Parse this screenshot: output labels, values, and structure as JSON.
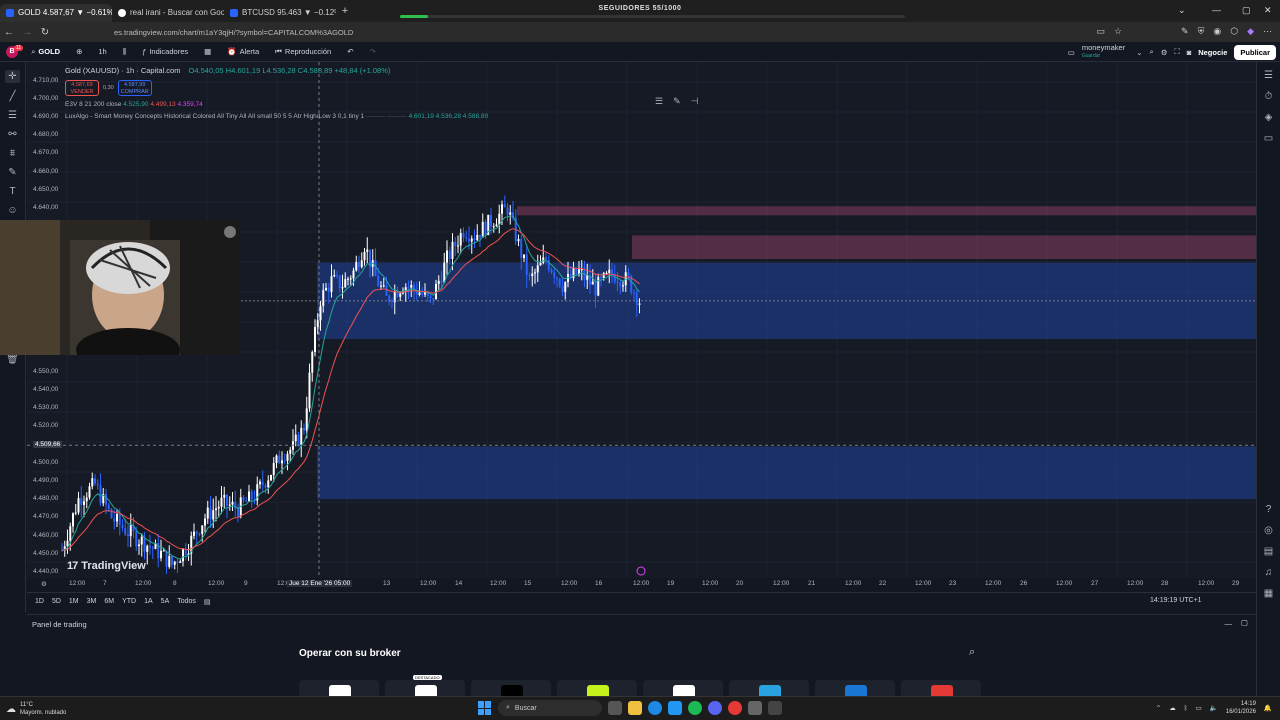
{
  "browser": {
    "tabs": [
      {
        "label": "GOLD 4.587,67 ▼ −0.61% mon",
        "active": true
      },
      {
        "label": "real irani - Buscar con Google",
        "active": false
      },
      {
        "label": "BTCUSD 95.463 ▼ −0.12% mo",
        "active": false
      }
    ],
    "new_tab": "+",
    "window_title": "SEGUIDORES 55/1000",
    "followers_progress": 0.055,
    "url": "es.tradingview.com/chart/m1aY3qjH/?symbol=CAPITALCOM%3AGOLD"
  },
  "toolbar": {
    "symbol": "GOLD",
    "interval": "1h",
    "indicators_label": "Indicadores",
    "alert_label": "Alerta",
    "replay_label": "Reproducción",
    "account_name": "moneymaker",
    "account_sub": "Guardar",
    "trade_label": "Negocie",
    "publish_label": "Publicar",
    "notification_count": "11"
  },
  "legend": {
    "title": "Gold (XAUUSD) · 1h · Capital.com",
    "ohlc": "O4.540,05 H4.601,19 L4.536,28 C4.588,89 +48,84 (+1.08%)",
    "sell_price": "4.587,69",
    "sell_label": "VENDER",
    "spread": "0,30",
    "buy_price": "4.587,99",
    "buy_label": "COMPRAR",
    "ema_label": "E3V 8 21 200 close",
    "ema_v1": "4.525,90",
    "ema_v2": "4.499,13",
    "ema_v3": "4.359,74",
    "luxalgo_label": "LuxAlgo - Smart Money Concepts Historical Colored All Tiny All All small 50 5 5 Atr High/Low 3 0,1 tiny 1",
    "luxalgo_values": "4.601,19  4.536,28  4.588,89"
  },
  "price_axis": {
    "labels": [
      "4.710,00",
      "4.700,00",
      "4.690,00",
      "4.680,00",
      "4.670,00",
      "4.660,00",
      "4.650,00",
      "4.640,00",
      "4.550,00",
      "4.540,00",
      "4.530,00",
      "4.520,00",
      "4.509,66",
      "4.500,00",
      "4.490,00",
      "4.480,00",
      "4.470,00",
      "4.460,00",
      "4.450,00",
      "4.440,00"
    ],
    "crosshair_price": "4.509,66"
  },
  "time_axis": {
    "labels": [
      "12:00",
      "7",
      "12:00",
      "8",
      "12:00",
      "9",
      "12:00",
      "Jue 12 Ene '26",
      "05:00",
      "13",
      "12:00",
      "14",
      "12:00",
      "15",
      "12:00",
      "16",
      "12:00",
      "19",
      "12:00",
      "20",
      "12:00",
      "21",
      "12:00",
      "22",
      "12:00",
      "23",
      "12:00",
      "26",
      "12:00",
      "27",
      "12:00",
      "28",
      "12:00",
      "29"
    ],
    "highlight": "Jue 12 Ene '26   05:00"
  },
  "watermark": "TradingView",
  "ranges": [
    "1D",
    "5D",
    "1M",
    "3M",
    "6M",
    "YTD",
    "1A",
    "5A",
    "Todos"
  ],
  "clock": "14:19:19 UTC+1",
  "panel": {
    "header": "Panel de trading",
    "title": "Operar con su broker",
    "featured_tag": "DESTACADO",
    "broker_colors": [
      "#ffffff",
      "#ffffff",
      "#000000",
      "#c6f21b",
      "#ffffff",
      "#29a3e0",
      "#1976d2",
      "#e53935"
    ]
  },
  "taskbar": {
    "temperature": "11°C",
    "weather": "Mayorm. nublado",
    "search": "Buscar",
    "time": "14:19",
    "date": "16/01/2026"
  },
  "colors": {
    "bull": "#ffffff",
    "bear": "#2962ff",
    "supply_zone": "#f06292",
    "demand_zone": "#2962ff",
    "ema_fast": "#26a69a",
    "ema_slow": "#ef5350"
  },
  "chart_data": {
    "type": "candlestick",
    "symbol": "GOLD",
    "interval": "1h",
    "close_path": [
      [
        0,
        4452
      ],
      [
        6,
        4480
      ],
      [
        12,
        4488
      ],
      [
        18,
        4470
      ],
      [
        24,
        4462
      ],
      [
        30,
        4456
      ],
      [
        36,
        4450
      ],
      [
        40,
        4444
      ],
      [
        46,
        4455
      ],
      [
        52,
        4470
      ],
      [
        58,
        4478
      ],
      [
        64,
        4475
      ],
      [
        70,
        4482
      ],
      [
        76,
        4495
      ],
      [
        80,
        4505
      ],
      [
        84,
        4508
      ],
      [
        88,
        4520
      ],
      [
        91,
        4560
      ],
      [
        94,
        4590
      ],
      [
        98,
        4600
      ],
      [
        102,
        4598
      ],
      [
        106,
        4605
      ],
      [
        110,
        4620
      ],
      [
        114,
        4602
      ],
      [
        118,
        4590
      ],
      [
        124,
        4598
      ],
      [
        130,
        4594
      ],
      [
        134,
        4588
      ],
      [
        140,
        4612
      ],
      [
        146,
        4628
      ],
      [
        150,
        4625
      ],
      [
        154,
        4630
      ],
      [
        158,
        4635
      ],
      [
        162,
        4640
      ],
      [
        166,
        4620
      ],
      [
        170,
        4600
      ],
      [
        176,
        4612
      ],
      [
        182,
        4598
      ],
      [
        188,
        4605
      ],
      [
        194,
        4596
      ],
      [
        200,
        4604
      ],
      [
        206,
        4600
      ],
      [
        210,
        4589
      ]
    ],
    "zones": [
      {
        "type": "supply",
        "from": 4636,
        "to": 4641
      },
      {
        "type": "supply",
        "from": 4612,
        "to": 4625
      },
      {
        "type": "demand",
        "from": 4590,
        "to": 4610
      },
      {
        "type": "demand",
        "from": 4568,
        "to": 4590
      },
      {
        "type": "demand",
        "from": 4480,
        "to": 4509
      }
    ]
  }
}
